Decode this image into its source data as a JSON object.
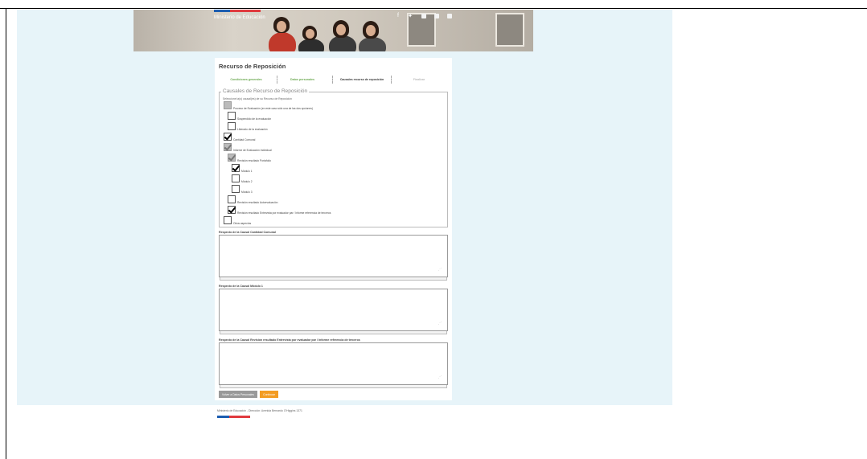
{
  "header": {
    "ministry": "Ministerio de Educación",
    "social_icons": [
      "facebook-icon",
      "twitter-icon",
      "mail-icon",
      "instagram-icon",
      "youtube-icon"
    ]
  },
  "form": {
    "title": "Recurso de Reposición",
    "steps": [
      {
        "label": "Condiciones generales",
        "state": "done"
      },
      {
        "label": "Datos personales",
        "state": "done"
      },
      {
        "label": "Causales recurso de reposición",
        "state": "active"
      },
      {
        "label": "Finalizar",
        "state": "pending"
      }
    ],
    "causales": {
      "legend": "Causales de Recurso de Reposición",
      "hint": "Seleccione la(s) causal(es) de su Recurso de Reposición",
      "options": [
        {
          "label": "Proceso de Evaluación (en este caso sólo una de las dos opciones)",
          "checked": false,
          "disabled": true
        },
        {
          "label": "Suspendido de la evaluación",
          "checked": false,
          "disabled": false
        },
        {
          "label": "Liberado de la evaluación",
          "checked": false,
          "disabled": false
        },
        {
          "label": "Cantidad Comunal",
          "checked": true,
          "disabled": false
        },
        {
          "label": "Informe de Evaluación Individual",
          "checked": true,
          "disabled": true
        },
        {
          "label": "Revisión resultado Portafolio",
          "checked": true,
          "disabled": true
        },
        {
          "label": "Módulo 1",
          "checked": true,
          "disabled": false
        },
        {
          "label": "Módulo 2",
          "checked": false,
          "disabled": false
        },
        {
          "label": "Módulo 3",
          "checked": false,
          "disabled": false
        },
        {
          "label": "Revisión resultado Autoevaluación",
          "checked": false,
          "disabled": false
        },
        {
          "label": "Revisión resultado Entrevista por evaluador par / Informe referencia de terceros",
          "checked": true,
          "disabled": false
        },
        {
          "label": "Otros aspectos",
          "checked": false,
          "disabled": false
        }
      ]
    },
    "responses": [
      {
        "label": "Respecto de la Causal Cantidad Comunal",
        "value": ""
      },
      {
        "label": "Respecto de la Causal Módulo 1",
        "value": ""
      },
      {
        "label": "Respecto de la Causal Revisión resultado Entrevista por evaluador par / Informe referencia de terceros",
        "value": ""
      }
    ],
    "buttons": {
      "back": "Volver a Datos Personales",
      "continue": "Continuar"
    }
  },
  "footer": {
    "text": "Ministerio de Educación - Dirección: Avenida Bernardo O'Higgins 1371"
  },
  "colors": {
    "page_bg": "#e7f4f9",
    "step_done": "#6aa84f",
    "continue_button": "#f39c23",
    "back_button": "#999999",
    "flag_blue": "#1c5db0",
    "flag_red": "#e03a3e"
  }
}
